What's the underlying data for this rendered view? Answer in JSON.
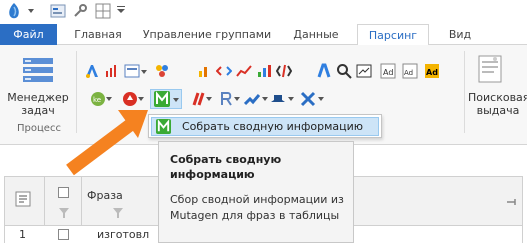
{
  "tabs": [
    "Файл",
    "Главная",
    "Управление группами",
    "Данные",
    "Парсинг",
    "Вид"
  ],
  "ribbon": {
    "manager_label_1": "Менеджер",
    "manager_label_2": "задач",
    "process_group_label": "Процесс",
    "search_results_label_1": "Поисковая",
    "search_results_label_2": "выдача"
  },
  "menu": {
    "item_label": "Собрать сводную информацию"
  },
  "tooltip": {
    "title": "Собрать сводную информацию",
    "body": "Сбор сводной информации из Mutagen для фраз в таблицы"
  },
  "grid": {
    "phrase_header": "Фраза",
    "row1_num": "1",
    "row1_text": "изготовл"
  },
  "colors": {
    "accent": "#2b6ec4",
    "arrow": "#f58220",
    "menu_highlight": "#cde4f7",
    "mutagen_green": "#3aaa35"
  }
}
